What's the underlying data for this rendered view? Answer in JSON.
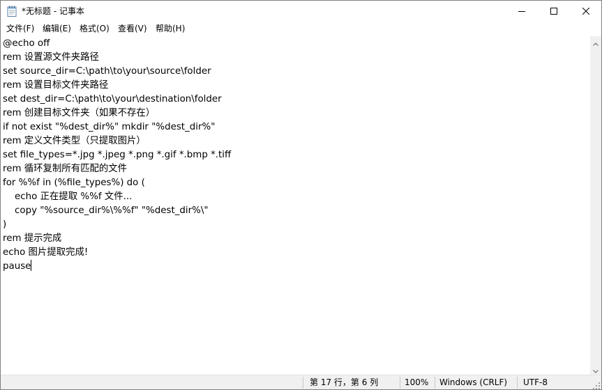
{
  "window": {
    "title": "*无标题 - 记事本",
    "app_icon": "notepad-icon",
    "controls": [
      "minimize-icon",
      "maximize-icon",
      "close-icon"
    ]
  },
  "menu": [
    {
      "label": "文件(F)"
    },
    {
      "label": "编辑(E)"
    },
    {
      "label": "格式(O)"
    },
    {
      "label": "查看(V)"
    },
    {
      "label": "帮助(H)"
    }
  ],
  "editor": {
    "lines": [
      "@echo off",
      "rem 设置源文件夹路径",
      "set source_dir=C:\\path\\to\\your\\source\\folder",
      "rem 设置目标文件夹路径",
      "set dest_dir=C:\\path\\to\\your\\destination\\folder",
      "rem 创建目标文件夹（如果不存在）",
      "if not exist \"%dest_dir%\" mkdir \"%dest_dir%\"",
      "rem 定义文件类型（只提取图片）",
      "set file_types=*.jpg *.jpeg *.png *.gif *.bmp *.tiff",
      "rem 循环复制所有匹配的文件",
      "for %%f in (%file_types%) do (",
      "    echo 正在提取 %%f 文件...",
      "    copy \"%source_dir%\\%%f\" \"%dest_dir%\\\"",
      ")",
      "rem 提示完成",
      "echo 图片提取完成!",
      "pause"
    ]
  },
  "status": {
    "position": "第 17 行，第 6 列",
    "zoom": "100%",
    "line_ending": "Windows (CRLF)",
    "encoding": "UTF-8"
  }
}
